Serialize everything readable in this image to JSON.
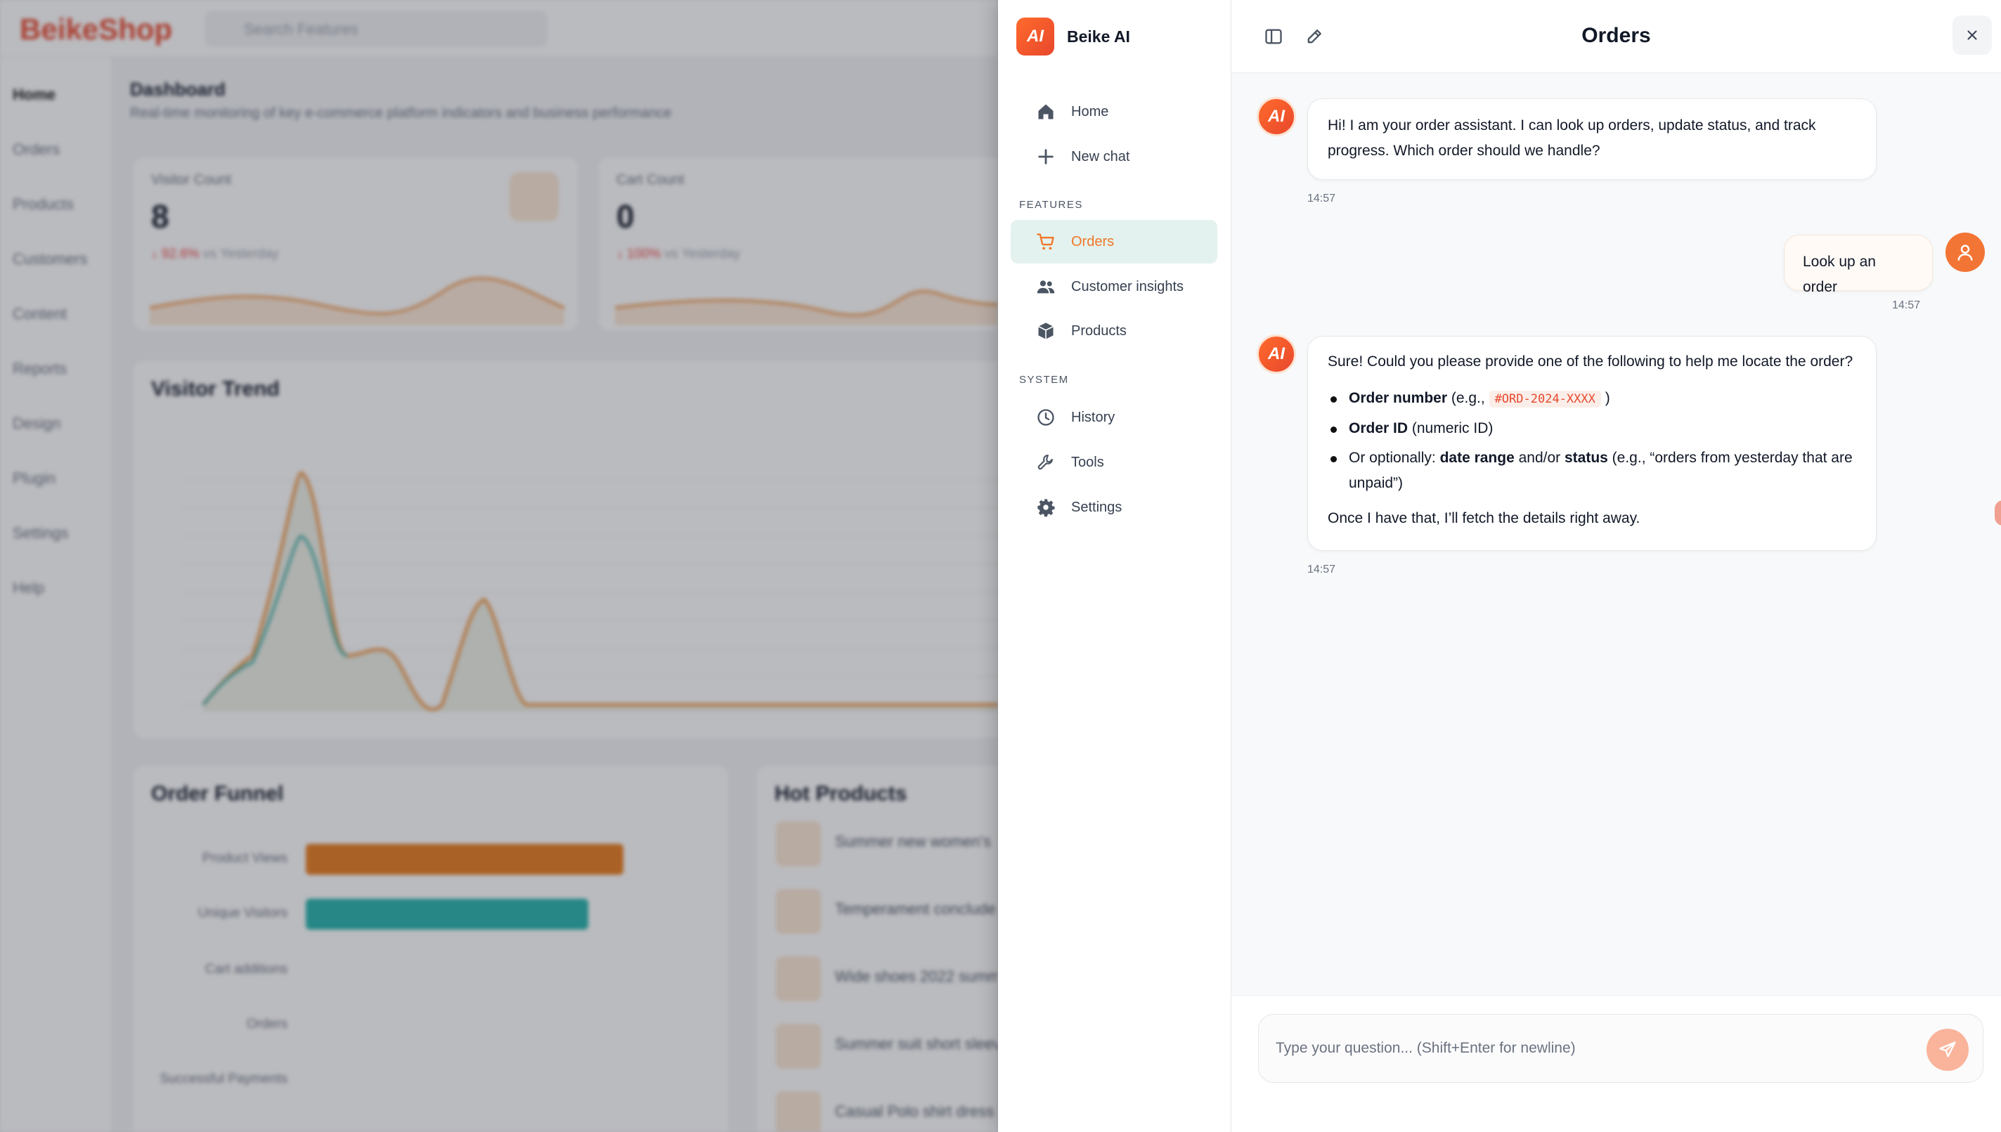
{
  "background": {
    "logo": "BeikeShop",
    "search_placeholder": "Search Features",
    "nav": [
      "Home",
      "Orders",
      "Products",
      "Customers",
      "Content",
      "Reports",
      "Design",
      "Plugin",
      "Settings",
      "Help"
    ],
    "title": "Dashboard",
    "subtitle": "Real-time monitoring of key e-commerce platform indicators and business performance",
    "cards": [
      {
        "label": "Visitor Count",
        "value": "8",
        "delta": "↓ 92.6%",
        "compare": "vs Yesterday"
      },
      {
        "label": "Cart Count",
        "value": "0",
        "delta": "↓ 100%",
        "compare": "vs Yesterday"
      }
    ],
    "trend_title": "Visitor Trend",
    "funnel_title": "Order Funnel",
    "funnel_labels": [
      "Product Views",
      "Unique Visitors",
      "Cart additions",
      "Orders",
      "Successful Payments"
    ],
    "hot_title": "Hot Products",
    "hot_items": [
      "Summer new women's",
      "Temperament conclude",
      "Wide shoes 2022 summ",
      "Summer suit short sleev",
      "Casual Polo shirt dress"
    ]
  },
  "assistant": {
    "brand": "Beike AI",
    "badge": "AI",
    "nav_top": [
      {
        "label": "Home",
        "icon": "home-icon"
      },
      {
        "label": "New chat",
        "icon": "plus-icon"
      }
    ],
    "features_label": "FEATURES",
    "features": [
      {
        "label": "Orders",
        "icon": "cart-icon",
        "active": true
      },
      {
        "label": "Customer insights",
        "icon": "users-icon"
      },
      {
        "label": "Products",
        "icon": "box-icon"
      }
    ],
    "system_label": "SYSTEM",
    "system": [
      {
        "label": "History",
        "icon": "clock-icon"
      },
      {
        "label": "Tools",
        "icon": "wrench-icon"
      },
      {
        "label": "Settings",
        "icon": "gear-icon"
      }
    ]
  },
  "chat": {
    "title": "Orders",
    "messages": [
      {
        "role": "assistant",
        "text": "Hi! I am your order assistant. I can look up orders, update status, and track progress. Which order should we handle?",
        "time": "14:57"
      },
      {
        "role": "user",
        "text": "Look up an order",
        "time": "14:57"
      },
      {
        "role": "assistant",
        "intro": "Sure! Could you please provide one of the following to help me locate the order?",
        "bullets": [
          {
            "bold": "Order number",
            "rest_pre": " (e.g., ",
            "code": "#ORD-2024-XXXX",
            "rest_post": " )"
          },
          {
            "bold": "Order ID",
            "rest": " (numeric ID)"
          },
          {
            "pre": "Or optionally: ",
            "bold1": "date range",
            "mid": " and/or ",
            "bold2": "status",
            "rest": " (e.g., “orders from yesterday that are unpaid”)"
          }
        ],
        "outro": "Once I have that, I’ll fetch the details right away.",
        "time": "14:57"
      }
    ],
    "input_placeholder": "Type your question... (Shift+Enter for newline)"
  },
  "colors": {
    "accent": "#f0762a",
    "active_bg": "#e3f2ee",
    "brand_red": "#e8482d"
  }
}
